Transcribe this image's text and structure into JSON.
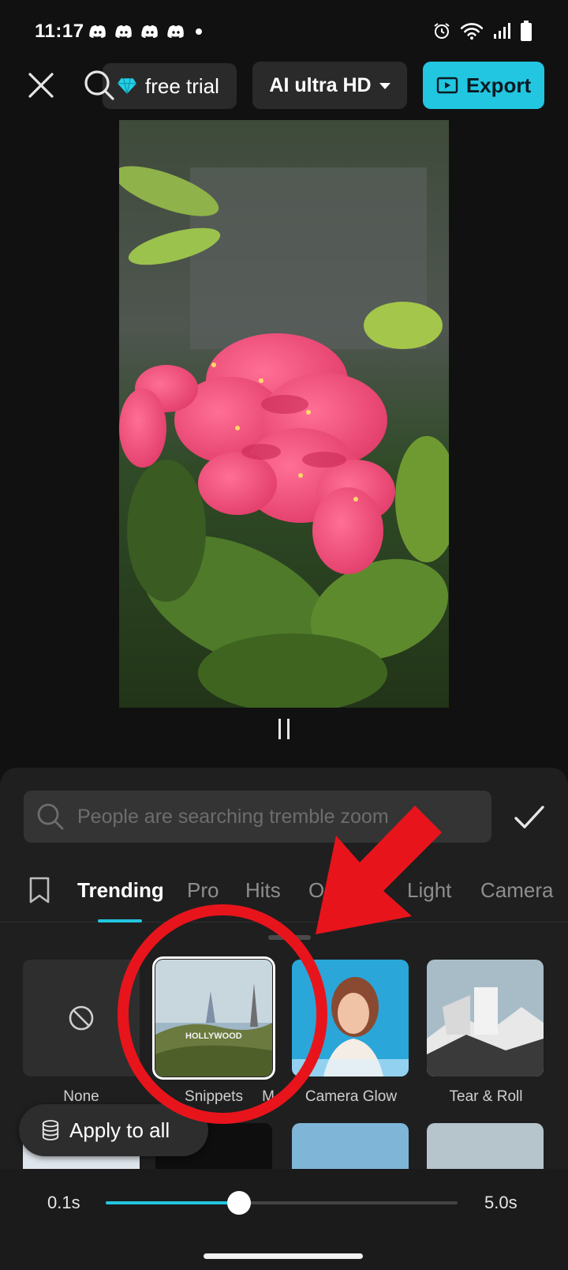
{
  "status_bar": {
    "time": "11:17",
    "app_icons": [
      "discord-icon",
      "discord-icon",
      "discord-icon",
      "discord-icon"
    ],
    "system_icons": [
      "alarm-icon",
      "wifi-icon",
      "signal-icon",
      "battery-icon"
    ]
  },
  "top_bar": {
    "trial_label": "free trial",
    "quality_label": "AI ultra HD",
    "export_label": "Export"
  },
  "preview": {
    "image": "pink ixora flower photo"
  },
  "effects_panel": {
    "search_placeholder": "People are searching tremble zoom",
    "tabs": [
      {
        "label": "Trending",
        "active": true
      },
      {
        "label": "Pro",
        "active": false
      },
      {
        "label": "Hits",
        "active": false
      },
      {
        "label": "O",
        "active": false
      },
      {
        "label": "Light",
        "active": false
      },
      {
        "label": "Camera",
        "active": false
      }
    ],
    "tiles": [
      {
        "label": "None"
      },
      {
        "label": "Snippets",
        "selected": true
      },
      {
        "label": "M"
      },
      {
        "label": "Camera Glow"
      },
      {
        "label": "Tear & Roll"
      }
    ],
    "apply_all_label": "Apply to all"
  },
  "duration_slider": {
    "min_label": "0.1s",
    "max_label": "5.0s",
    "position_fraction": 0.38
  },
  "colors": {
    "accent": "#22c6e0",
    "background": "#111111",
    "panel": "#1f1f1f",
    "annotation_red": "#e8141c"
  }
}
